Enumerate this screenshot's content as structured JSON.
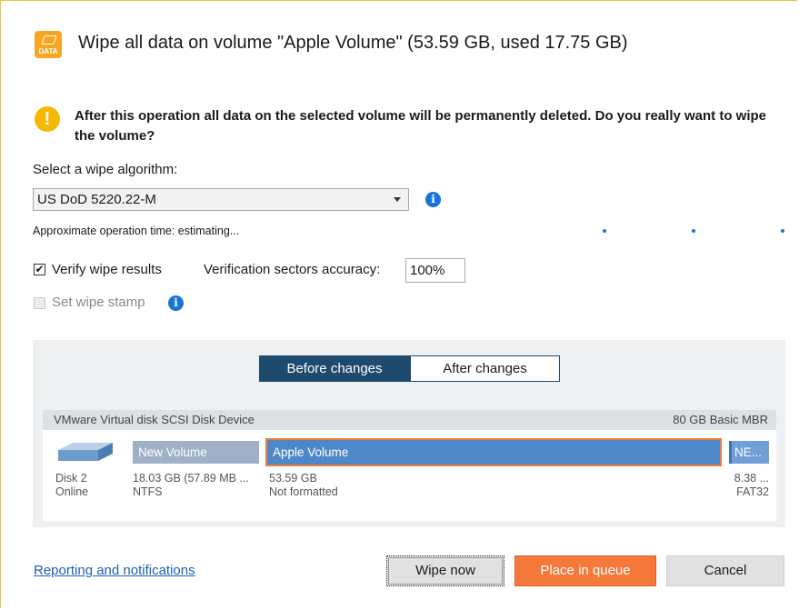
{
  "dialog": {
    "title": "Wipe all data on volume \"Apple Volume\" (53.59 GB, used 17.75 GB)",
    "title_icon_text": "DATA",
    "title_icon": "data-eraser-icon"
  },
  "warning": {
    "icon": "warning-icon",
    "text": "After this operation all data on the selected volume will be permanently deleted. Do you really want to wipe the volume?"
  },
  "algorithm": {
    "label": "Select a wipe algorithm:",
    "selected": "US DoD 5220.22-M",
    "info_icon": "info-icon",
    "info_glyph": "i",
    "operation_time": "Approximate operation time: estimating..."
  },
  "verify": {
    "checked": true,
    "check_glyph": "✔",
    "label": "Verify wipe results",
    "accuracy_label": "Verification sectors accuracy:",
    "accuracy_value": "100%"
  },
  "stamp": {
    "checked": false,
    "label": "Set wipe stamp",
    "info_glyph": "i"
  },
  "view_toggle": {
    "before": "Before changes",
    "after": "After changes",
    "active": "before"
  },
  "disk": {
    "name": "VMware Virtual disk SCSI Disk Device",
    "size_info": "80 GB Basic MBR",
    "label": "Disk 2",
    "status": "Online",
    "partitions": [
      {
        "name": "New Volume",
        "size": "18.03 GB (57.89 MB ...",
        "fs": "NTFS",
        "color": "#9eb1c8"
      },
      {
        "name": "Apple Volume",
        "size": "53.59 GB",
        "fs": "Not formatted",
        "color": "#4f88c9",
        "selected": true
      },
      {
        "name": "NE...",
        "size": "8.38 ...",
        "fs": "FAT32",
        "color": "#6f9fd4"
      }
    ]
  },
  "footer": {
    "link": "Reporting and notifications",
    "wipe_now": "Wipe now",
    "place_in_queue": "Place in queue",
    "cancel": "Cancel"
  },
  "colors": {
    "accent_orange": "#f4793b",
    "selection_border": "#f4793b",
    "toggle_active": "#1e4a6e",
    "link": "#1a5fb4",
    "info_blue": "#1a73d9"
  }
}
